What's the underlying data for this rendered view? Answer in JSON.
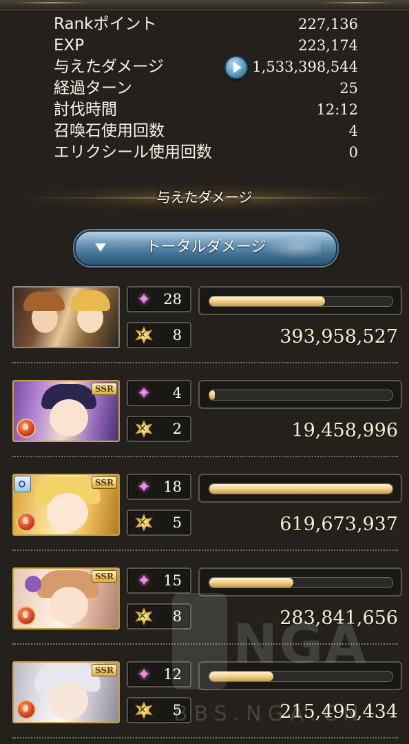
{
  "stats": [
    {
      "label": "Rankポイント",
      "value": "227,136"
    },
    {
      "label": "EXP",
      "value": "223,174"
    },
    {
      "label": "与えたダメージ",
      "value": "1,533,398,544"
    },
    {
      "label": "経過ターン",
      "value": "25"
    },
    {
      "label": "討伐時間",
      "value": "12:12"
    },
    {
      "label": "召喚石使用回数",
      "value": "4"
    },
    {
      "label": "エリクシール使用回数",
      "value": "0"
    }
  ],
  "section_title": "与えたダメージ",
  "dropdown": {
    "label": "トータルダメージ"
  },
  "characters": [
    {
      "ougi_count": "28",
      "skill_count": "8",
      "damage": "393,958,527",
      "bar_fraction": 0.63,
      "rarity_badge": ""
    },
    {
      "ougi_count": "4",
      "skill_count": "2",
      "damage": "19,458,996",
      "bar_fraction": 0.03,
      "rarity_badge": "SSR"
    },
    {
      "ougi_count": "18",
      "skill_count": "5",
      "damage": "619,673,937",
      "bar_fraction": 1.0,
      "rarity_badge": "SSR"
    },
    {
      "ougi_count": "15",
      "skill_count": "8",
      "damage": "283,841,656",
      "bar_fraction": 0.46,
      "rarity_badge": "SSR"
    },
    {
      "ougi_count": "12",
      "skill_count": "5",
      "damage": "215,495,434",
      "bar_fraction": 0.35,
      "rarity_badge": "SSR"
    }
  ],
  "watermark": {
    "logo": "NGA",
    "site": "BBS.NGA.CN"
  },
  "colors": {
    "bar_fill": "#f5d28e",
    "rarity_border": "#c9a24a",
    "dropdown_blue": "#4f7fa3"
  }
}
